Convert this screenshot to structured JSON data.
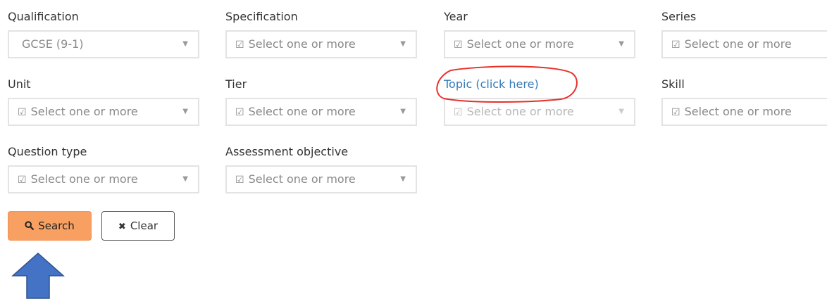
{
  "fields": [
    {
      "id": "qualification",
      "label": "Qualification",
      "value": "GCSE (9-1)",
      "disabled": false,
      "link": false
    },
    {
      "id": "specification",
      "label": "Specification",
      "placeholder": "Select one or more",
      "disabled": false,
      "link": false
    },
    {
      "id": "year",
      "label": "Year",
      "placeholder": "Select one or more",
      "disabled": false,
      "link": false
    },
    {
      "id": "series",
      "label": "Series",
      "placeholder": "Select one or more",
      "disabled": false,
      "link": false
    },
    {
      "id": "unit",
      "label": "Unit",
      "placeholder": "Select one or more",
      "disabled": false,
      "link": false
    },
    {
      "id": "tier",
      "label": "Tier",
      "placeholder": "Select one or more",
      "disabled": false,
      "link": false
    },
    {
      "id": "topic",
      "label": "Topic (click here)",
      "placeholder": "Select one or more",
      "disabled": true,
      "link": true
    },
    {
      "id": "skill",
      "label": "Skill",
      "placeholder": "Select one or more",
      "disabled": false,
      "link": false
    },
    {
      "id": "question-type",
      "label": "Question type",
      "placeholder": "Select one or more",
      "disabled": false,
      "link": false
    },
    {
      "id": "assessment-objective",
      "label": "Assessment objective",
      "placeholder": "Select one or more",
      "disabled": false,
      "link": false
    }
  ],
  "buttons": {
    "search_label": "Search",
    "clear_label": "Clear",
    "search_icon": "search-icon",
    "clear_icon": "close-icon"
  },
  "icons": {
    "checkbox": "checkbox-icon",
    "caret": "caret-down-icon"
  },
  "colors": {
    "search_button": "#f7a061",
    "link": "#337ab7",
    "annotation_ellipse": "#e8302a",
    "annotation_arrow": "#4472c4"
  }
}
